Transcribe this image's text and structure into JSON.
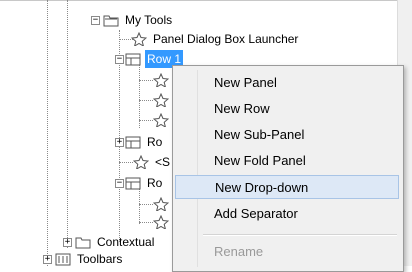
{
  "tree": {
    "my_tools": "My Tools",
    "panel_dialog": "Panel Dialog Box Launcher",
    "row1": "Row 1",
    "ro_a": "Ro",
    "s_item": "<S",
    "ro_b": "Ro",
    "contextual": "Contextual",
    "toolbars": "Toolbars"
  },
  "menu": {
    "items": [
      "New Panel",
      "New Row",
      "New Sub-Panel",
      "New Fold Panel",
      "New Drop-down",
      "Add Separator",
      "Rename"
    ],
    "hover_index": 4,
    "disabled_index": 6
  },
  "colors": {
    "selection": "#3399ff",
    "menu_bg": "#f0f0f0",
    "hover": "#dde8f6"
  }
}
